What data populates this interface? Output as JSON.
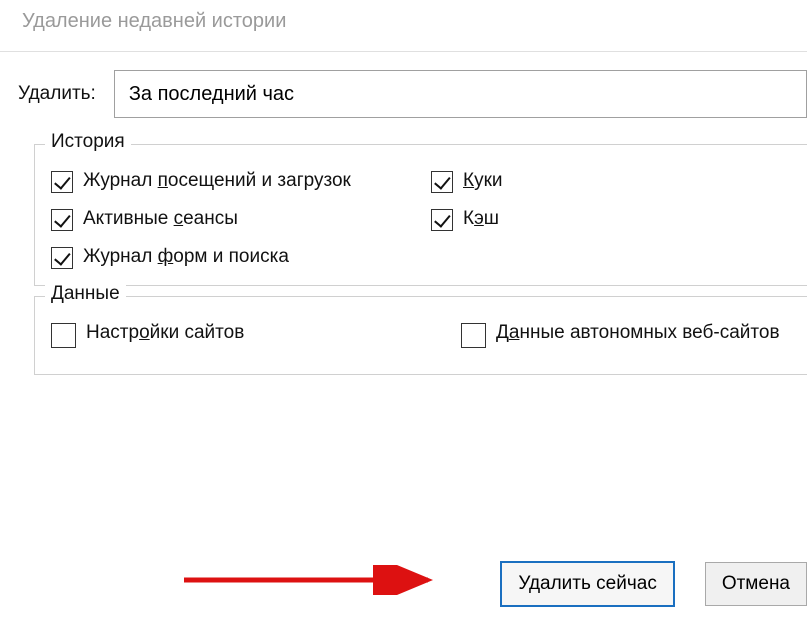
{
  "window": {
    "title": "Удаление недавней истории"
  },
  "timeRange": {
    "label": "Удалить:",
    "selected": "За последний час"
  },
  "groups": {
    "history": {
      "legend": "История",
      "items": {
        "browsing": {
          "label_pre": "Журнал ",
          "label_ul": "п",
          "label_post": "осещений и загрузок",
          "checked": true
        },
        "cookies": {
          "label_pre": "",
          "label_ul": "К",
          "label_post": "уки",
          "checked": true
        },
        "sessions": {
          "label_pre": "Активные ",
          "label_ul": "с",
          "label_post": "еансы",
          "checked": true
        },
        "cache": {
          "label_pre": "К",
          "label_ul": "э",
          "label_post": "ш",
          "checked": true
        },
        "forms": {
          "label_pre": "Журнал ",
          "label_ul": "ф",
          "label_post": "орм и поиска",
          "checked": true
        }
      }
    },
    "data": {
      "legend": "Данные",
      "items": {
        "siteSettings": {
          "label_pre": "Настр",
          "label_ul": "о",
          "label_post": "йки сайтов",
          "checked": false
        },
        "offline": {
          "label_pre": "Д",
          "label_ul": "а",
          "label_post": "нные автономных веб-сайтов",
          "checked": false
        }
      }
    }
  },
  "buttons": {
    "clear": "Удалить сейчас",
    "cancel": "Отмена"
  }
}
